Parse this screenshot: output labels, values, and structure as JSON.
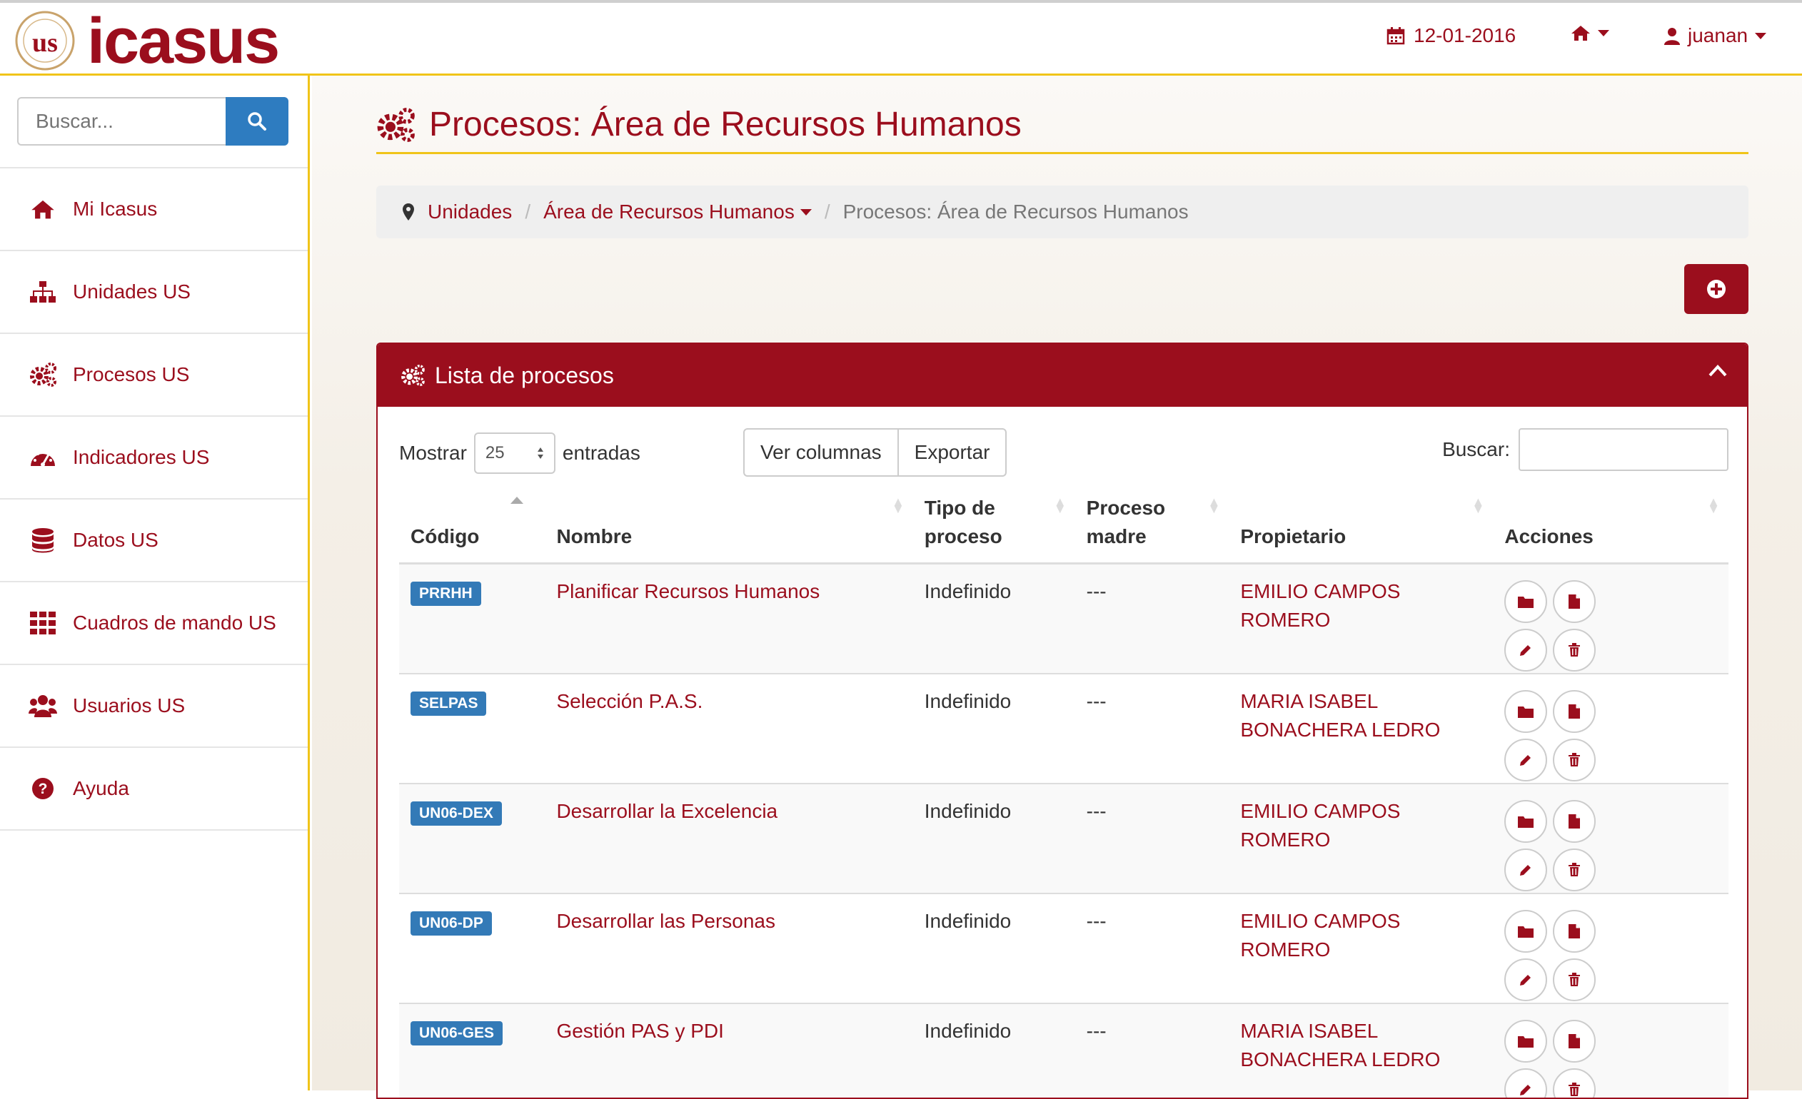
{
  "app": {
    "brand": "icasus"
  },
  "navbar": {
    "date": "12-01-2016",
    "user": "juanan"
  },
  "sidebar": {
    "search_placeholder": "Buscar...",
    "items": [
      {
        "label": "Mi Icasus",
        "icon": "home-icon"
      },
      {
        "label": "Unidades US",
        "icon": "sitemap-icon"
      },
      {
        "label": "Procesos US",
        "icon": "gears-icon"
      },
      {
        "label": "Indicadores US",
        "icon": "dashboard-icon"
      },
      {
        "label": "Datos US",
        "icon": "database-icon"
      },
      {
        "label": "Cuadros de mando US",
        "icon": "grid-icon"
      },
      {
        "label": "Usuarios US",
        "icon": "users-icon"
      },
      {
        "label": "Ayuda",
        "icon": "question-circle-icon"
      }
    ]
  },
  "page": {
    "title": "Procesos: Área de Recursos Humanos"
  },
  "breadcrumb": {
    "unidades": "Unidades",
    "area": "Área de Recursos Humanos",
    "current": "Procesos: Área de Recursos Humanos"
  },
  "panel": {
    "title": "Lista de procesos",
    "show_label": "Mostrar",
    "page_size": "25",
    "entries_label": "entradas",
    "columns_button": "Ver columnas",
    "export_button": "Exportar",
    "search_label": "Buscar:"
  },
  "table": {
    "headers": {
      "codigo": "Código",
      "nombre": "Nombre",
      "tipo": "Tipo de proceso",
      "madre": "Proceso madre",
      "propietario": "Propietario",
      "acciones": "Acciones"
    },
    "rows": [
      {
        "code": "PRRHH",
        "name": "Planificar Recursos Humanos",
        "type": "Indefinido",
        "parent": "---",
        "owner": "EMILIO CAMPOS ROMERO"
      },
      {
        "code": "SELPAS",
        "name": "Selección P.A.S.",
        "type": "Indefinido",
        "parent": "---",
        "owner": "MARIA ISABEL BONACHERA LEDRO"
      },
      {
        "code": "UN06-DEX",
        "name": "Desarrollar la Excelencia",
        "type": "Indefinido",
        "parent": "---",
        "owner": "EMILIO CAMPOS ROMERO"
      },
      {
        "code": "UN06-DP",
        "name": "Desarrollar las Personas",
        "type": "Indefinido",
        "parent": "---",
        "owner": "EMILIO CAMPOS ROMERO"
      },
      {
        "code": "UN06-GES",
        "name": "Gestión PAS y PDI",
        "type": "Indefinido",
        "parent": "---",
        "owner": "MARIA ISABEL BONACHERA LEDRO"
      }
    ]
  },
  "colors": {
    "accent": "#9b0e1d",
    "yellow": "#f0c419",
    "badge": "#337ab7"
  }
}
